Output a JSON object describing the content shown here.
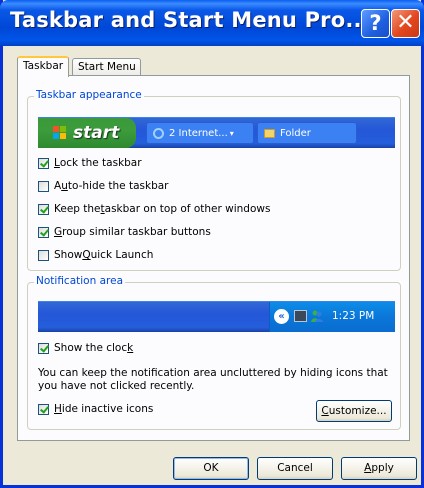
{
  "window": {
    "title": "Taskbar and Start Menu Pro...",
    "help_label": "?",
    "close_label": "✕"
  },
  "tabs": [
    {
      "label": "Taskbar",
      "active": true
    },
    {
      "label": "Start Menu",
      "active": false
    }
  ],
  "taskbar_group": {
    "title": "Taskbar appearance",
    "preview": {
      "start_label": "start",
      "task1_label": "2 Internet...",
      "task1_arrow": "▾",
      "task2_label": "Folder"
    },
    "options": [
      {
        "pre": "",
        "ul": "L",
        "post": "ock the taskbar",
        "checked": true
      },
      {
        "pre": "A",
        "ul": "u",
        "post": "to-hide the taskbar",
        "checked": false
      },
      {
        "pre": "Keep the ",
        "ul": "t",
        "post": "askbar on top of other windows",
        "checked": true
      },
      {
        "pre": "",
        "ul": "G",
        "post": "roup similar taskbar buttons",
        "checked": true
      },
      {
        "pre": "Show ",
        "ul": "Q",
        "post": "uick Launch",
        "checked": false
      }
    ]
  },
  "notification_group": {
    "title": "Notification area",
    "preview": {
      "chevron": "«",
      "clock": "1:23 PM"
    },
    "show_clock": {
      "pre": "Show the cloc",
      "ul": "k",
      "post": "",
      "checked": true
    },
    "description": "You can keep the notification area uncluttered by hiding icons that you have not clicked recently.",
    "hide_inactive": {
      "pre": "",
      "ul": "H",
      "post": "ide inactive icons",
      "checked": true
    },
    "customize": {
      "pre": "",
      "ul": "C",
      "post": "ustomize..."
    }
  },
  "buttons": {
    "ok": "OK",
    "cancel": "Cancel",
    "apply_ul": "A",
    "apply_rest": "pply"
  },
  "colors": {
    "title_bar": "#0a58e8",
    "start_button": "#3c9c3c",
    "taskbar": "#245edb",
    "tray": "#0b77d9",
    "group_title": "#0046d5"
  }
}
